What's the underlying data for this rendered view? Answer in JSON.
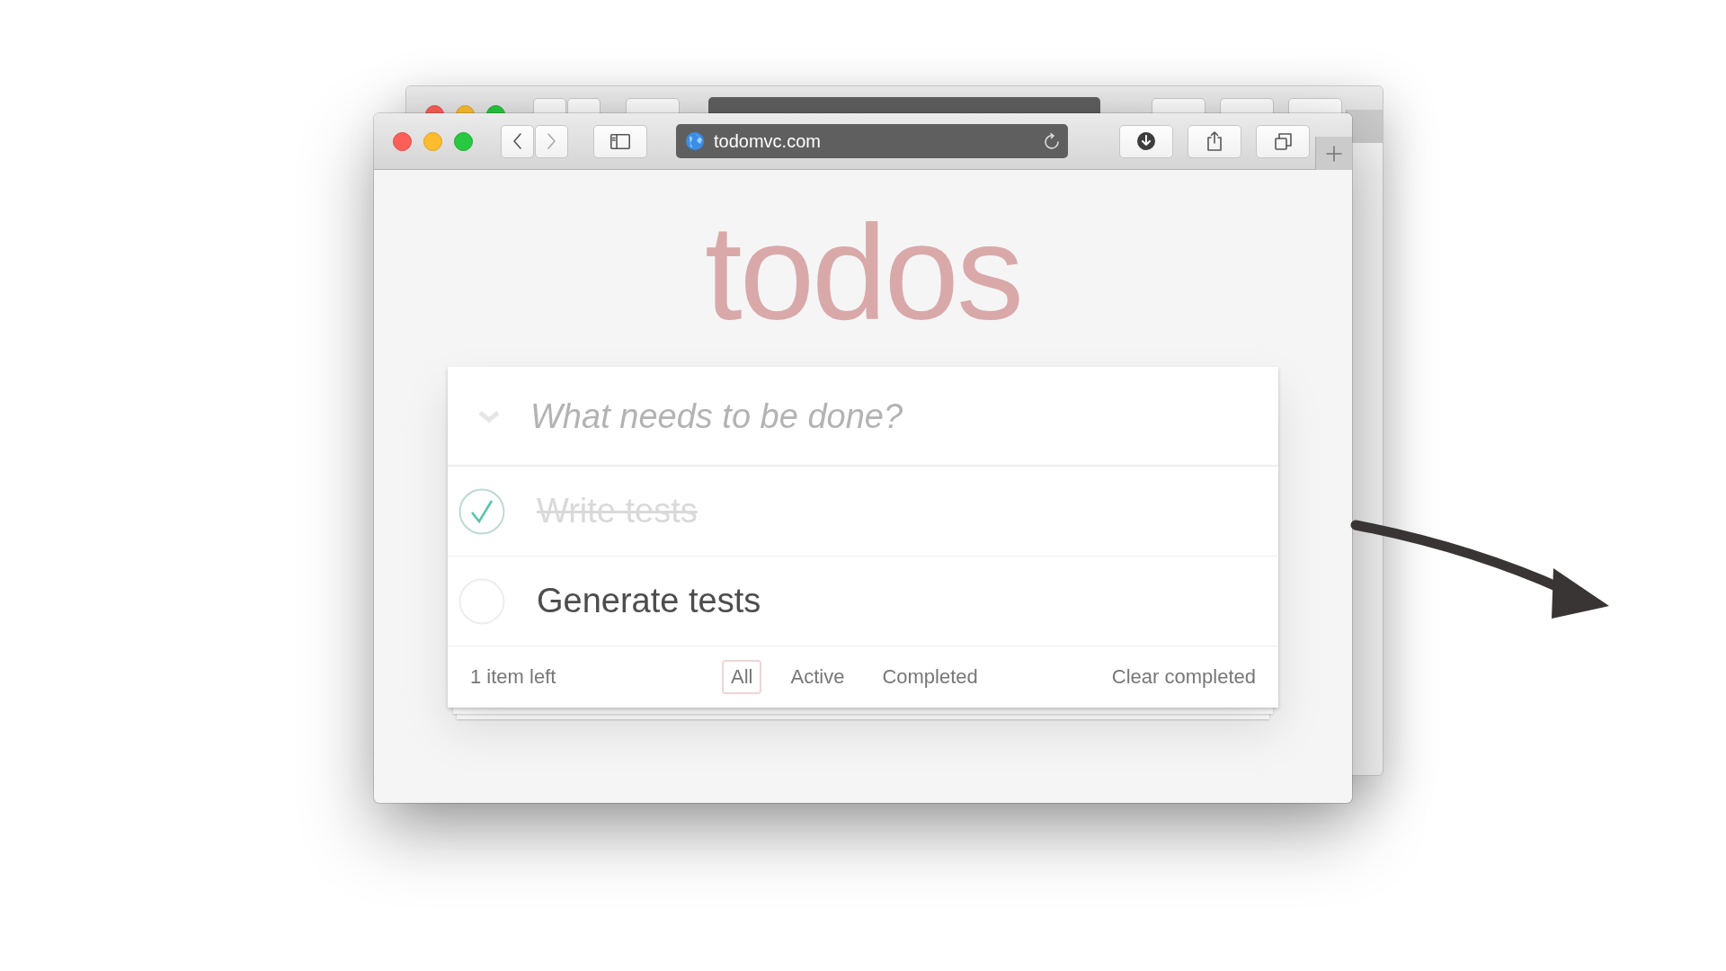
{
  "browser": {
    "url": "todomvc.com"
  },
  "app": {
    "title": "todos",
    "new_todo": {
      "placeholder": "What needs to be done?"
    },
    "todos": [
      {
        "title": "Write tests",
        "completed": true
      },
      {
        "title": "Generate tests",
        "completed": false
      }
    ],
    "footer": {
      "count": "1 item left",
      "filters": [
        {
          "label": "All",
          "selected": true
        },
        {
          "label": "Active",
          "selected": false
        },
        {
          "label": "Completed",
          "selected": false
        }
      ],
      "clear": "Clear completed"
    }
  }
}
